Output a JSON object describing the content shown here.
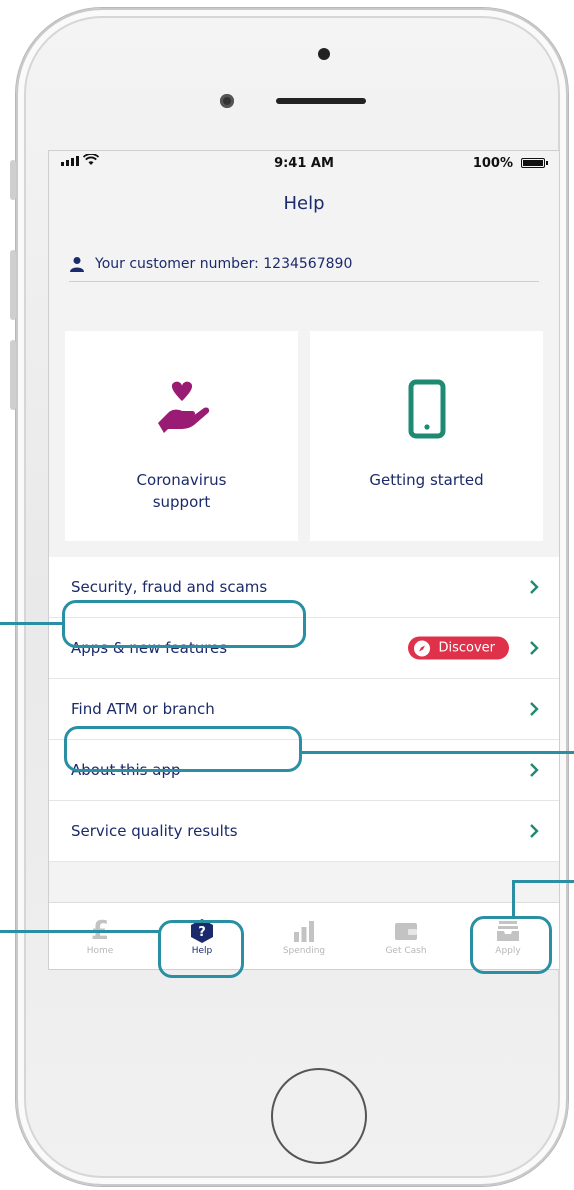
{
  "status_bar": {
    "time": "9:41 AM",
    "battery": "100%"
  },
  "header": {
    "title": "Help"
  },
  "customer": {
    "text": "Your customer number: 1234567890",
    "icon": "person-icon"
  },
  "cards": [
    {
      "label": "Coronavirus support",
      "icon": "heart-hand-icon",
      "icon_color": "#9a1b74"
    },
    {
      "label": "Getting started",
      "icon": "phone-icon",
      "icon_color": "#1f8a72"
    }
  ],
  "menu": [
    {
      "label": "Security, fraud and scams"
    },
    {
      "label": "Apps & new features",
      "badge": "Discover"
    },
    {
      "label": "Find ATM or branch"
    },
    {
      "label": "About this app"
    },
    {
      "label": "Service quality results"
    }
  ],
  "tabs": [
    {
      "label": "Home",
      "icon": "pound-icon"
    },
    {
      "label": "Help",
      "icon": "help-hex-icon"
    },
    {
      "label": "Spending",
      "icon": "bar-chart-icon"
    },
    {
      "label": "Get Cash",
      "icon": "wallet-icon"
    },
    {
      "label": "Apply",
      "icon": "tray-icon"
    }
  ],
  "colors": {
    "brand": "#1b2a6b",
    "accent_red": "#e0314b",
    "highlight": "#2a8fa3",
    "chevron": "#1f8a72"
  }
}
